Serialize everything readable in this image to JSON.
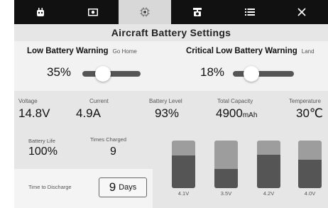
{
  "tabs": [
    {
      "icon": "robot-face-icon",
      "active": false
    },
    {
      "icon": "camera-icon",
      "active": false
    },
    {
      "icon": "battery-chip-icon",
      "active": true
    },
    {
      "icon": "gimbal-camera-icon",
      "active": false
    },
    {
      "icon": "list-icon",
      "active": false
    },
    {
      "icon": "close-icon",
      "active": false
    }
  ],
  "title": "Aircraft Battery Settings",
  "low_warning": {
    "label": "Low Battery Warning",
    "action": "Go Home",
    "value": "35%",
    "level": 0.35
  },
  "critical_warning": {
    "label": "Critical Low Battery Warning",
    "action": "Land",
    "value": "18%",
    "level": 0.18
  },
  "stats": {
    "voltage": {
      "label": "Voltage",
      "value": "14.8V"
    },
    "current": {
      "label": "Current",
      "value": "4.9A"
    },
    "battery_level": {
      "label": "Battery Level",
      "value": "93%"
    },
    "total_capacity": {
      "label": "Total Capacity",
      "value": "4900",
      "unit": "mAh"
    },
    "temperature": {
      "label": "Temperature",
      "value": "30℃"
    }
  },
  "battery_life": {
    "label": "Battery Life",
    "value": "100%"
  },
  "times_charged": {
    "label": "Times Charged",
    "value": "9"
  },
  "discharge": {
    "label": "Time to Discharge",
    "value": "9",
    "unit": "Days"
  },
  "cells": [
    {
      "label": "4.1V",
      "fill": 0.68
    },
    {
      "label": "3.5V",
      "fill": 0.4
    },
    {
      "label": "4.2V",
      "fill": 0.7
    },
    {
      "label": "4.0V",
      "fill": 0.6
    }
  ],
  "colors": {
    "tabbar": "#111111",
    "active_tab": "#d8d8d8",
    "panel": "#e6e6e6",
    "slider": "#555555",
    "cell_empty": "#9d9d9d",
    "cell_fill": "#555555"
  }
}
